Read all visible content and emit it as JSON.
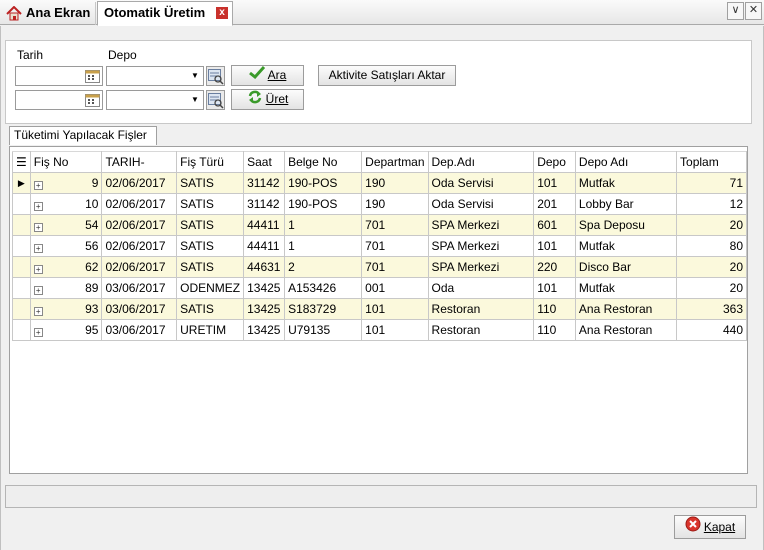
{
  "tabs": {
    "home": "Ana Ekran",
    "active": "Otomatik Üretim",
    "close_glyph": "x"
  },
  "window_buttons": {
    "dropdown": "∨",
    "close": "✕"
  },
  "filters": {
    "date_label": "Tarih",
    "depot_label": "Depo",
    "date1": "",
    "date2": "",
    "depot1": "",
    "depot2": "",
    "search_button": "Ara",
    "produce_button": "Üret",
    "transfer_button": "Aktivite Satışları Aktar"
  },
  "group_title": "Tüketimi Yapılacak Fişler",
  "grid": {
    "columns": [
      "Fiş No",
      "TARIH-",
      "Fiş Türü",
      "Saat",
      "Belge No",
      "Departman",
      "Dep.Adı",
      "Depo",
      "Depo Adı",
      "Toplam"
    ],
    "rows": [
      {
        "fis_no": "9",
        "tarih": "02/06/2017",
        "tur": "SATIS",
        "saat": "31142",
        "belge": "190-POS",
        "dept": "190",
        "dep_adi": "Oda Servisi",
        "depo": "101",
        "depo_adi": "Mutfak",
        "toplam": "71"
      },
      {
        "fis_no": "10",
        "tarih": "02/06/2017",
        "tur": "SATIS",
        "saat": "31142",
        "belge": "190-POS",
        "dept": "190",
        "dep_adi": "Oda Servisi",
        "depo": "201",
        "depo_adi": "Lobby Bar",
        "toplam": "12"
      },
      {
        "fis_no": "54",
        "tarih": "02/06/2017",
        "tur": "SATIS",
        "saat": "44411",
        "belge": "1",
        "dept": "701",
        "dep_adi": "SPA Merkezi",
        "depo": "601",
        "depo_adi": "Spa Deposu",
        "toplam": "20"
      },
      {
        "fis_no": "56",
        "tarih": "02/06/2017",
        "tur": "SATIS",
        "saat": "44411",
        "belge": "1",
        "dept": "701",
        "dep_adi": "SPA Merkezi",
        "depo": "101",
        "depo_adi": "Mutfak",
        "toplam": "80"
      },
      {
        "fis_no": "62",
        "tarih": "02/06/2017",
        "tur": "SATIS",
        "saat": "44631",
        "belge": "2",
        "dept": "701",
        "dep_adi": "SPA Merkezi",
        "depo": "220",
        "depo_adi": "Disco Bar",
        "toplam": "20"
      },
      {
        "fis_no": "89",
        "tarih": "03/06/2017",
        "tur": "ODENMEZ",
        "saat": "13425",
        "belge": "A153426",
        "dept": "001",
        "dep_adi": "Oda",
        "depo": "101",
        "depo_adi": "Mutfak",
        "toplam": "20"
      },
      {
        "fis_no": "93",
        "tarih": "03/06/2017",
        "tur": "SATIS",
        "saat": "13425",
        "belge": "S183729",
        "dept": "101",
        "dep_adi": "Restoran",
        "depo": "110",
        "depo_adi": "Ana Restoran",
        "toplam": "363"
      },
      {
        "fis_no": "95",
        "tarih": "03/06/2017",
        "tur": "URETIM",
        "saat": "13425",
        "belge": "U79135",
        "dept": "101",
        "dep_adi": "Restoran",
        "depo": "110",
        "depo_adi": "Ana Restoran",
        "toplam": "440"
      }
    ]
  },
  "status": "",
  "close_button": "Kapat"
}
